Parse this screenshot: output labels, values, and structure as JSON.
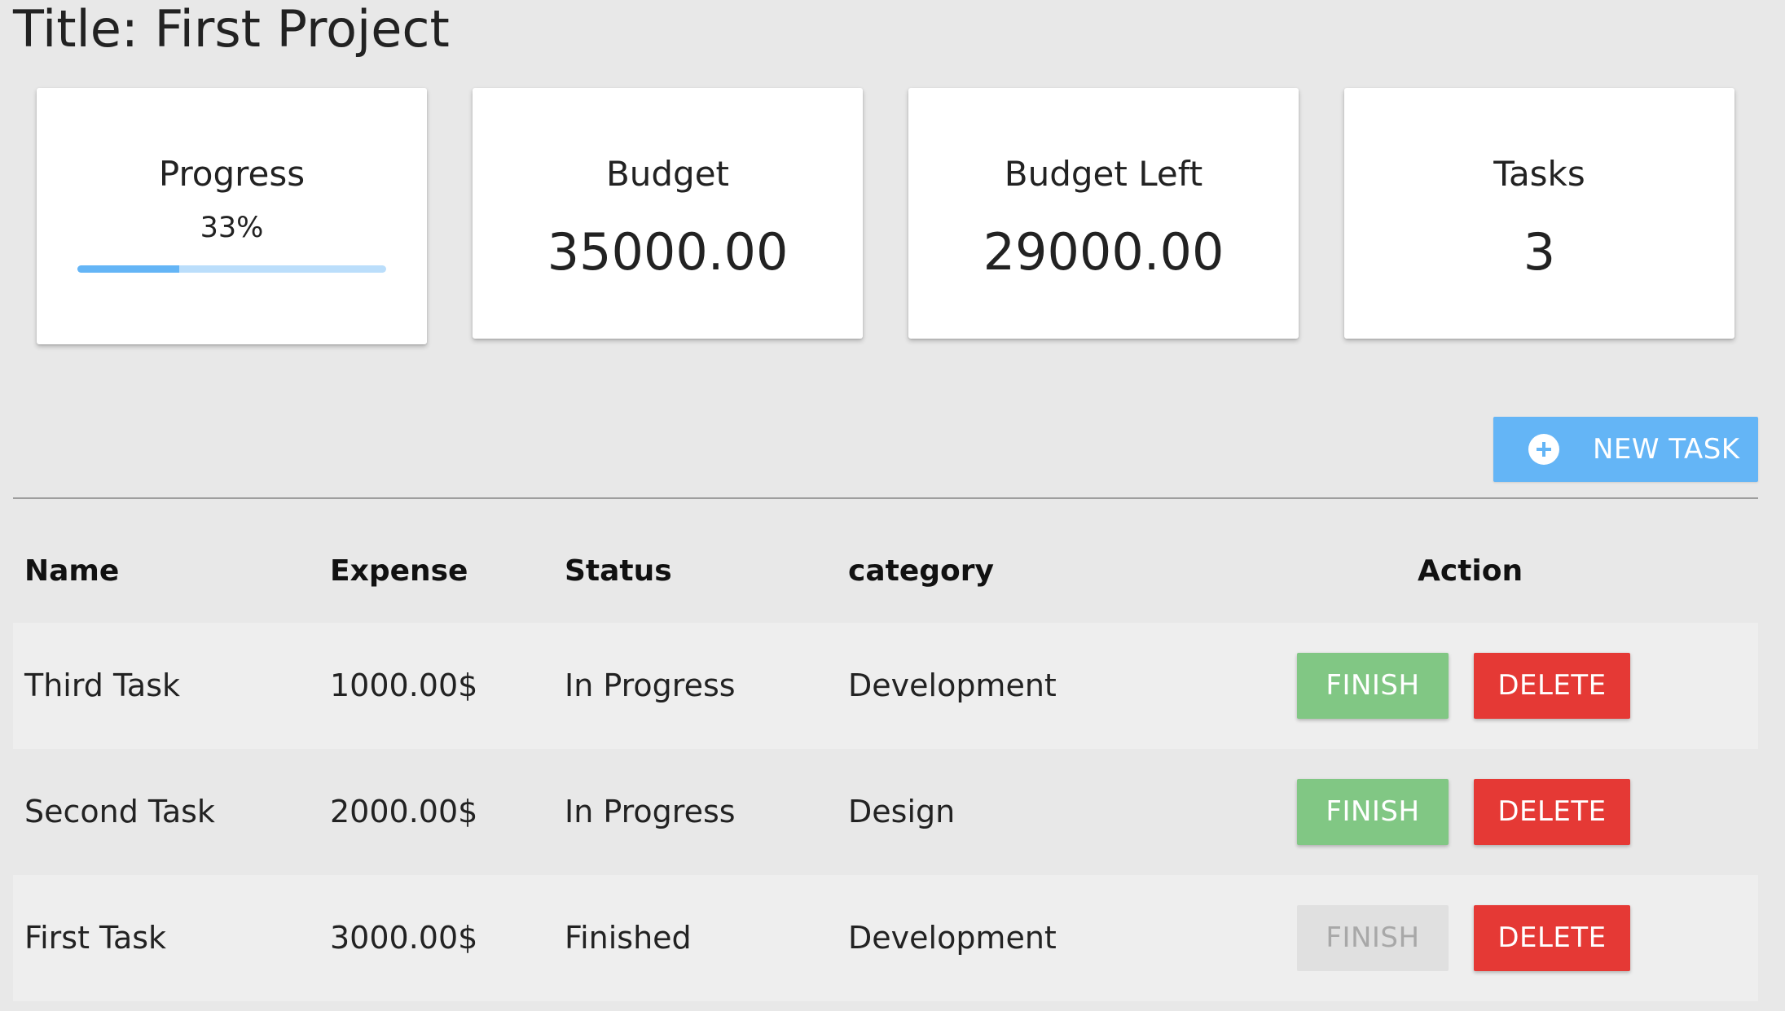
{
  "page": {
    "title": "Title: First Project"
  },
  "stats": {
    "progress": {
      "label": "Progress",
      "percent_text": "33%",
      "fraction": 0.33
    },
    "budget": {
      "label": "Budget",
      "value": "35000.00"
    },
    "budget_left": {
      "label": "Budget Left",
      "value": "29000.00"
    },
    "tasks": {
      "label": "Tasks",
      "value": "3"
    }
  },
  "toolbar": {
    "new_task_label": "NEW TASK",
    "new_task_icon": "plus-circle-icon"
  },
  "table": {
    "headers": {
      "name": "Name",
      "expense": "Expense",
      "status": "Status",
      "category": "category",
      "action": "Action"
    },
    "rows": [
      {
        "name": "Third Task",
        "expense": "1000.00$",
        "status": "In Progress",
        "category": "Development",
        "finish_label": "FINISH",
        "delete_label": "DELETE",
        "finish_enabled": true
      },
      {
        "name": "Second Task",
        "expense": "2000.00$",
        "status": "In Progress",
        "category": "Design",
        "finish_label": "FINISH",
        "delete_label": "DELETE",
        "finish_enabled": true
      },
      {
        "name": "First Task",
        "expense": "3000.00$",
        "status": "Finished",
        "category": "Development",
        "finish_label": "FINISH",
        "delete_label": "DELETE",
        "finish_enabled": false
      }
    ]
  },
  "colors": {
    "background": "#e8e8e8",
    "primary": "#64b5f6",
    "progress_track": "#bbdefb",
    "finish": "#81c784",
    "finish_disabled": "#e0e0e0",
    "delete": "#e53935"
  }
}
